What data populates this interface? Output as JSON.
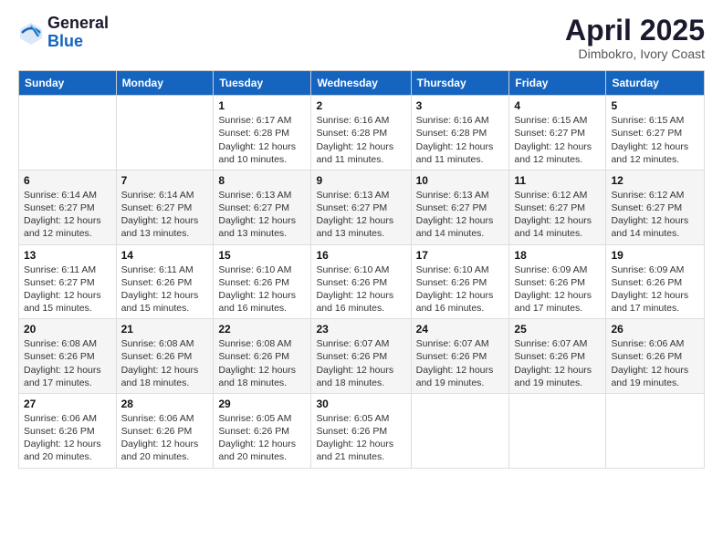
{
  "header": {
    "logo_general": "General",
    "logo_blue": "Blue",
    "month_title": "April 2025",
    "location": "Dimbokro, Ivory Coast"
  },
  "days_of_week": [
    "Sunday",
    "Monday",
    "Tuesday",
    "Wednesday",
    "Thursday",
    "Friday",
    "Saturday"
  ],
  "weeks": [
    [
      {
        "day": "",
        "info": ""
      },
      {
        "day": "",
        "info": ""
      },
      {
        "day": "1",
        "info": "Sunrise: 6:17 AM\nSunset: 6:28 PM\nDaylight: 12 hours and 10 minutes."
      },
      {
        "day": "2",
        "info": "Sunrise: 6:16 AM\nSunset: 6:28 PM\nDaylight: 12 hours and 11 minutes."
      },
      {
        "day": "3",
        "info": "Sunrise: 6:16 AM\nSunset: 6:28 PM\nDaylight: 12 hours and 11 minutes."
      },
      {
        "day": "4",
        "info": "Sunrise: 6:15 AM\nSunset: 6:27 PM\nDaylight: 12 hours and 12 minutes."
      },
      {
        "day": "5",
        "info": "Sunrise: 6:15 AM\nSunset: 6:27 PM\nDaylight: 12 hours and 12 minutes."
      }
    ],
    [
      {
        "day": "6",
        "info": "Sunrise: 6:14 AM\nSunset: 6:27 PM\nDaylight: 12 hours and 12 minutes."
      },
      {
        "day": "7",
        "info": "Sunrise: 6:14 AM\nSunset: 6:27 PM\nDaylight: 12 hours and 13 minutes."
      },
      {
        "day": "8",
        "info": "Sunrise: 6:13 AM\nSunset: 6:27 PM\nDaylight: 12 hours and 13 minutes."
      },
      {
        "day": "9",
        "info": "Sunrise: 6:13 AM\nSunset: 6:27 PM\nDaylight: 12 hours and 13 minutes."
      },
      {
        "day": "10",
        "info": "Sunrise: 6:13 AM\nSunset: 6:27 PM\nDaylight: 12 hours and 14 minutes."
      },
      {
        "day": "11",
        "info": "Sunrise: 6:12 AM\nSunset: 6:27 PM\nDaylight: 12 hours and 14 minutes."
      },
      {
        "day": "12",
        "info": "Sunrise: 6:12 AM\nSunset: 6:27 PM\nDaylight: 12 hours and 14 minutes."
      }
    ],
    [
      {
        "day": "13",
        "info": "Sunrise: 6:11 AM\nSunset: 6:27 PM\nDaylight: 12 hours and 15 minutes."
      },
      {
        "day": "14",
        "info": "Sunrise: 6:11 AM\nSunset: 6:26 PM\nDaylight: 12 hours and 15 minutes."
      },
      {
        "day": "15",
        "info": "Sunrise: 6:10 AM\nSunset: 6:26 PM\nDaylight: 12 hours and 16 minutes."
      },
      {
        "day": "16",
        "info": "Sunrise: 6:10 AM\nSunset: 6:26 PM\nDaylight: 12 hours and 16 minutes."
      },
      {
        "day": "17",
        "info": "Sunrise: 6:10 AM\nSunset: 6:26 PM\nDaylight: 12 hours and 16 minutes."
      },
      {
        "day": "18",
        "info": "Sunrise: 6:09 AM\nSunset: 6:26 PM\nDaylight: 12 hours and 17 minutes."
      },
      {
        "day": "19",
        "info": "Sunrise: 6:09 AM\nSunset: 6:26 PM\nDaylight: 12 hours and 17 minutes."
      }
    ],
    [
      {
        "day": "20",
        "info": "Sunrise: 6:08 AM\nSunset: 6:26 PM\nDaylight: 12 hours and 17 minutes."
      },
      {
        "day": "21",
        "info": "Sunrise: 6:08 AM\nSunset: 6:26 PM\nDaylight: 12 hours and 18 minutes."
      },
      {
        "day": "22",
        "info": "Sunrise: 6:08 AM\nSunset: 6:26 PM\nDaylight: 12 hours and 18 minutes."
      },
      {
        "day": "23",
        "info": "Sunrise: 6:07 AM\nSunset: 6:26 PM\nDaylight: 12 hours and 18 minutes."
      },
      {
        "day": "24",
        "info": "Sunrise: 6:07 AM\nSunset: 6:26 PM\nDaylight: 12 hours and 19 minutes."
      },
      {
        "day": "25",
        "info": "Sunrise: 6:07 AM\nSunset: 6:26 PM\nDaylight: 12 hours and 19 minutes."
      },
      {
        "day": "26",
        "info": "Sunrise: 6:06 AM\nSunset: 6:26 PM\nDaylight: 12 hours and 19 minutes."
      }
    ],
    [
      {
        "day": "27",
        "info": "Sunrise: 6:06 AM\nSunset: 6:26 PM\nDaylight: 12 hours and 20 minutes."
      },
      {
        "day": "28",
        "info": "Sunrise: 6:06 AM\nSunset: 6:26 PM\nDaylight: 12 hours and 20 minutes."
      },
      {
        "day": "29",
        "info": "Sunrise: 6:05 AM\nSunset: 6:26 PM\nDaylight: 12 hours and 20 minutes."
      },
      {
        "day": "30",
        "info": "Sunrise: 6:05 AM\nSunset: 6:26 PM\nDaylight: 12 hours and 21 minutes."
      },
      {
        "day": "",
        "info": ""
      },
      {
        "day": "",
        "info": ""
      },
      {
        "day": "",
        "info": ""
      }
    ]
  ]
}
